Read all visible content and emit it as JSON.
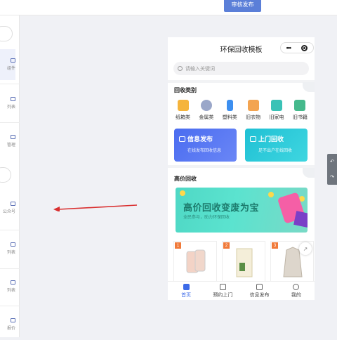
{
  "topbar": {
    "publish_label": "审核发布"
  },
  "left_panel": {
    "items": [
      {
        "label": "组件"
      },
      {
        "label": "列表"
      },
      {
        "label": "管理"
      },
      {
        "label": "公众号"
      },
      {
        "label": "列表"
      },
      {
        "label": "列表"
      },
      {
        "label": "报价"
      }
    ]
  },
  "phone": {
    "title": "环保回收模板",
    "capsule": {
      "menu": "•••"
    },
    "search_placeholder": "请输入关键词",
    "category_section": {
      "title": "回收类别",
      "items": [
        {
          "label": "纸箱类",
          "color": "#f5b43c",
          "icon": "box-icon"
        },
        {
          "label": "金属类",
          "color": "#9aa7c9",
          "icon": "metal-icon"
        },
        {
          "label": "塑料类",
          "color": "#3d8ff0",
          "icon": "bottle-icon"
        },
        {
          "label": "旧衣物",
          "color": "#f3a451",
          "icon": "shirt-icon"
        },
        {
          "label": "旧家电",
          "color": "#3ac2b6",
          "icon": "appliance-icon"
        },
        {
          "label": "旧书籍",
          "color": "#45b98c",
          "icon": "book-icon"
        }
      ]
    },
    "cards": [
      {
        "title": "信息发布",
        "subtitle": "在线发布回收信息",
        "color": "#4a6cf0"
      },
      {
        "title": "上门回收",
        "subtitle": "足不出户在线回收",
        "color": "#2ec6d8"
      }
    ],
    "high_price_section": {
      "title": "高价回收",
      "banner_title": "高价回收变废为宝",
      "banner_subtitle": "全民参与，助力环保回收"
    },
    "products": [
      {
        "tag": "1",
        "icon": "iphone-icon"
      },
      {
        "tag": "2",
        "icon": "liquor-box-icon"
      },
      {
        "tag": "3",
        "icon": "coat-icon"
      }
    ],
    "tabbar": [
      {
        "label": "首页",
        "active": true
      },
      {
        "label": "预约上门",
        "active": false
      },
      {
        "label": "信息发布",
        "active": false
      },
      {
        "label": "我的",
        "active": false
      }
    ]
  },
  "colors": {
    "accent": "#5b7fd8",
    "arrow": "#d92f2f",
    "tab_active": "#3d6be8"
  }
}
